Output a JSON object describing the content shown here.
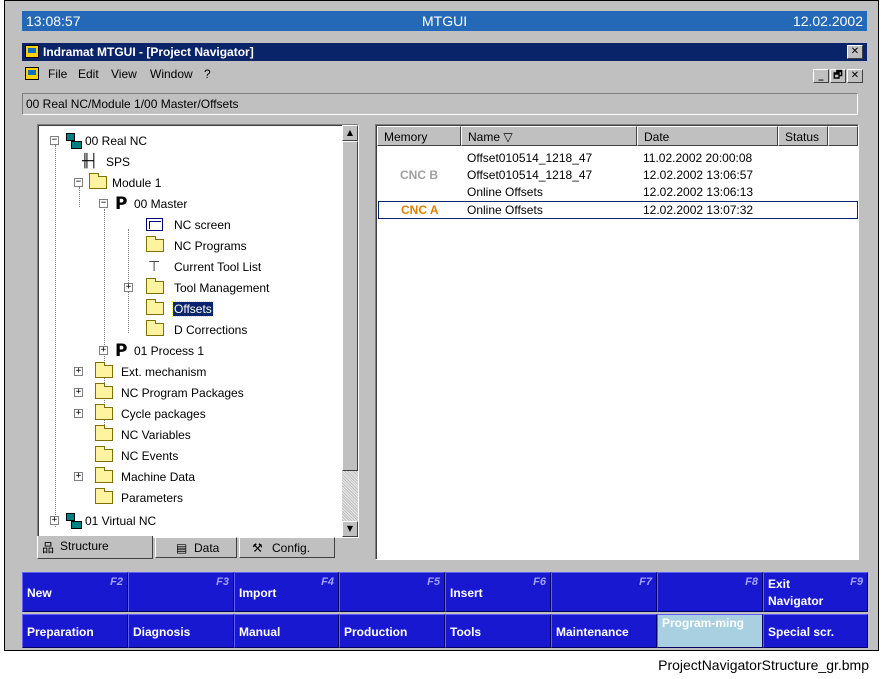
{
  "status_bar": {
    "time": "13:08:57",
    "app": "MTGUI",
    "date": "12.02.2002"
  },
  "window": {
    "title": "Indramat MTGUI - [Project Navigator]",
    "close": "✕"
  },
  "menu": {
    "items": [
      "File",
      "Edit",
      "View",
      "Window",
      "?"
    ],
    "mdi": [
      "_",
      "🗗",
      "✕"
    ]
  },
  "path": "00 Real NC/Module 1/00 Master/Offsets",
  "tree": {
    "items": [
      {
        "label": "00 Real NC",
        "icon": "network-icon",
        "expander": "−"
      },
      {
        "label": "SPS",
        "icon": "sps-icon"
      },
      {
        "label": "Module 1",
        "icon": "folder-icon",
        "expander": "−"
      },
      {
        "label": "00 Master",
        "icon": "process-icon",
        "expander": "−"
      },
      {
        "label": "NC screen",
        "icon": "screen-icon"
      },
      {
        "label": "NC Programs",
        "icon": "folder-icon"
      },
      {
        "label": "Current Tool List",
        "icon": "tool-icon"
      },
      {
        "label": "Tool Management",
        "icon": "folder-icon",
        "expander": "+"
      },
      {
        "label": "Offsets",
        "icon": "folder-icon",
        "selected": true
      },
      {
        "label": "D Corrections",
        "icon": "folder-icon"
      },
      {
        "label": "01 Process 1",
        "icon": "process-icon",
        "expander": "+"
      },
      {
        "label": "Ext. mechanism",
        "icon": "folder-icon",
        "expander": "+"
      },
      {
        "label": "NC Program Packages",
        "icon": "folder-icon",
        "expander": "+"
      },
      {
        "label": "Cycle packages",
        "icon": "folder-icon",
        "expander": "+"
      },
      {
        "label": "NC Variables",
        "icon": "folder-icon"
      },
      {
        "label": "NC Events",
        "icon": "folder-icon"
      },
      {
        "label": "Machine Data",
        "icon": "folder-icon",
        "expander": "+"
      },
      {
        "label": "Parameters",
        "icon": "folder-icon"
      },
      {
        "label": "01 Virtual NC",
        "icon": "network-icon",
        "expander": "+"
      }
    ]
  },
  "tabs": [
    {
      "label": "Structure",
      "icon": "structure-icon",
      "active": true
    },
    {
      "label": "Data",
      "icon": "data-icon"
    },
    {
      "label": "Config.",
      "icon": "wrench-icon"
    }
  ],
  "list": {
    "columns": [
      "Memory",
      "Name ▽",
      "Date",
      "Status"
    ],
    "rows": [
      {
        "memory": "",
        "name": "Offset010514_1218_47",
        "date": "11.02.2002 20:00:08"
      },
      {
        "memory": "CNC B",
        "name": "Offset010514_1218_47",
        "date": "12.02.2002 13:06:57"
      },
      {
        "memory": "",
        "name": "Online Offsets",
        "date": "12.02.2002 13:06:13"
      },
      {
        "memory": "CNC A",
        "name": "Online Offsets",
        "date": "12.02.2002 13:07:32",
        "selected": true
      }
    ],
    "memory_colors": {
      "CNC B": "#a0a0a0",
      "CNC A": "#e08000"
    }
  },
  "fkeys": [
    {
      "label": "New",
      "key": "F2"
    },
    {
      "label": "",
      "key": "F3"
    },
    {
      "label": "Import",
      "key": "F4"
    },
    {
      "label": "",
      "key": "F5"
    },
    {
      "label": "Insert",
      "key": "F6"
    },
    {
      "label": "",
      "key": "F7"
    },
    {
      "label": "",
      "key": "F8"
    },
    {
      "label": "Exit Navigator",
      "key": "F9"
    }
  ],
  "nav_keys": [
    "Preparation",
    "Diagnosis",
    "Manual",
    "Production",
    "Tools",
    "Maintenance",
    "Program-ming",
    "Special scr."
  ],
  "caption": "ProjectNavigatorStructure_gr.bmp"
}
